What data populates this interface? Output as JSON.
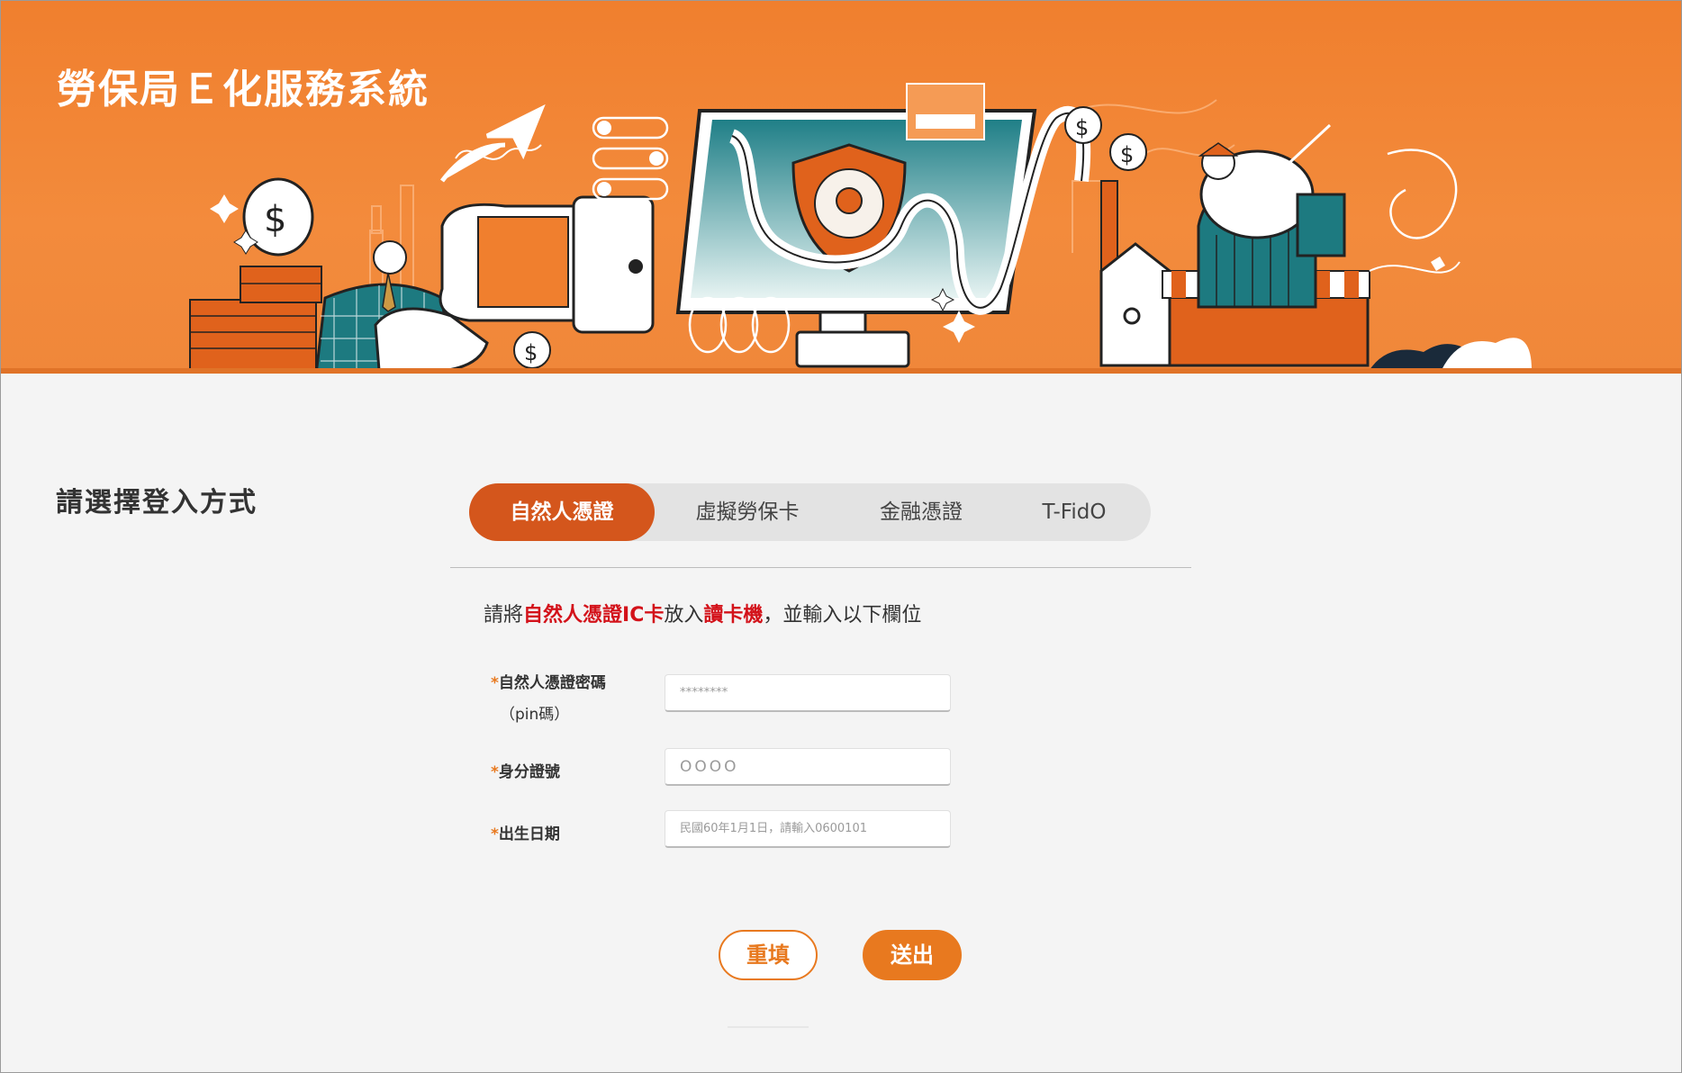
{
  "header": {
    "title": "勞保局Ｅ化服務系統"
  },
  "login": {
    "heading": "請選擇登入方式",
    "tabs": [
      {
        "label": "自然人憑證",
        "active": true
      },
      {
        "label": "虛擬勞保卡",
        "active": false
      },
      {
        "label": "金融憑證",
        "active": false
      },
      {
        "label": "T-FidO",
        "active": false
      }
    ],
    "instruction": {
      "part1": "請將",
      "highlight1": "自然人憑證IC卡",
      "part2": "放入",
      "highlight2": "讀卡機",
      "part3": "，並輸入以下欄位"
    },
    "fields": {
      "pin": {
        "required_mark": "*",
        "label": "自然人憑證密碼",
        "sublabel": "（pin碼）",
        "placeholder": "********"
      },
      "id": {
        "required_mark": "*",
        "label": "身分證號",
        "placeholder": "OOOO"
      },
      "birth": {
        "required_mark": "*",
        "label": "出生日期",
        "placeholder": "民國60年1月1日，請輸入0600101"
      }
    },
    "buttons": {
      "reset": "重填",
      "submit": "送出"
    }
  },
  "colors": {
    "banner_orange": "#f38b3c",
    "tab_active": "#d4561c",
    "accent": "#e8791f",
    "highlight_red": "#d3121a"
  }
}
